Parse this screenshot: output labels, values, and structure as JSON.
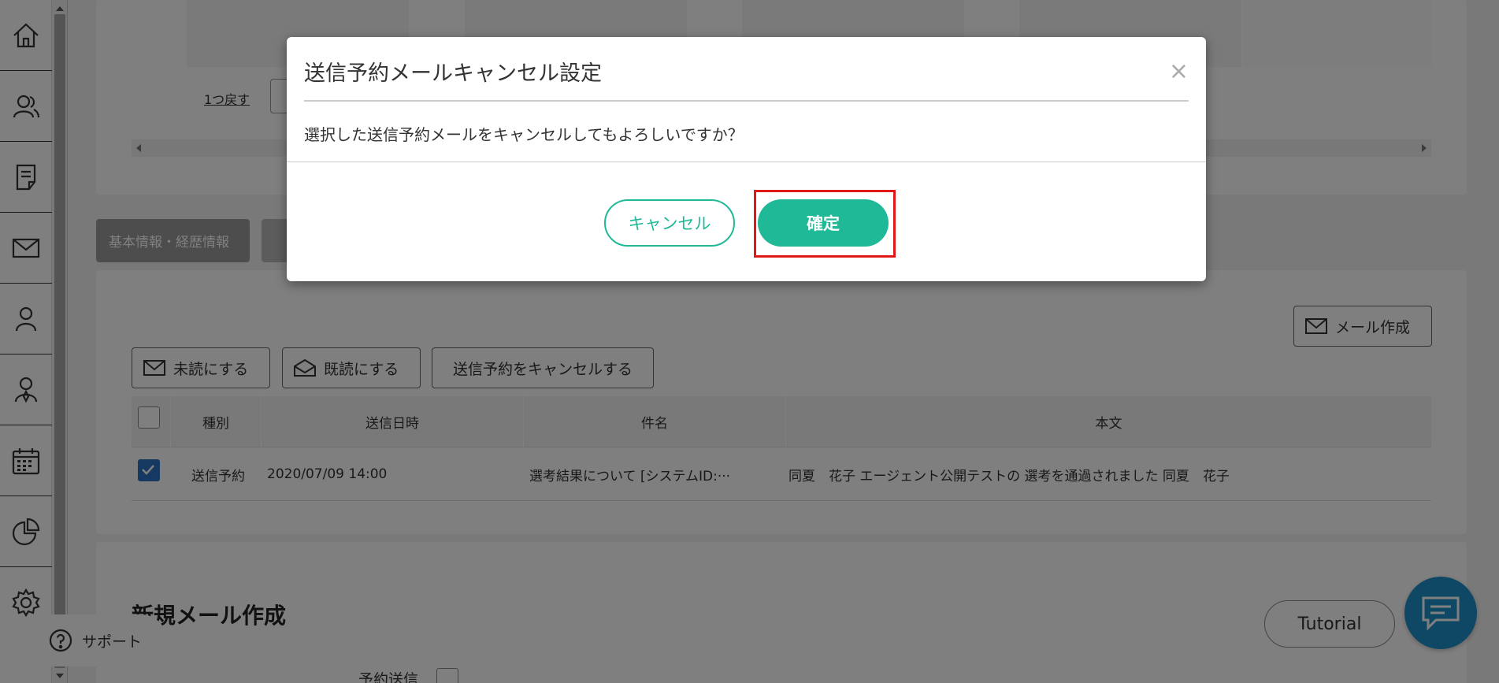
{
  "sidebar": {
    "items": [
      {
        "icon": "home-icon"
      },
      {
        "icon": "users-icon"
      },
      {
        "icon": "document-icon"
      },
      {
        "icon": "mail-icon"
      },
      {
        "icon": "user-icon"
      },
      {
        "icon": "agent-icon"
      },
      {
        "icon": "calendar-icon"
      },
      {
        "icon": "pie-chart-icon"
      },
      {
        "icon": "gear-icon"
      }
    ]
  },
  "top_section": {
    "back_link": "1つ戻す"
  },
  "tabs": {
    "basic_info": "基本情報・経歴情報"
  },
  "mail_section": {
    "create_mail": "メール作成",
    "mark_unread": "未読にする",
    "mark_read": "既読にする",
    "cancel_scheduled": "送信予約をキャンセルする",
    "columns": [
      "種別",
      "送信日時",
      "件名",
      "本文"
    ],
    "rows": [
      {
        "checked": true,
        "type": "送信予約",
        "sent_at": "2020/07/09 14:00",
        "subject": "選考結果について [システムID:···",
        "body": "同夏　花子 エージェント公開テストの 選考を通過されました 同夏　花子"
      }
    ]
  },
  "new_mail": {
    "title": "新規メール作成",
    "reserve_label": "予約送信",
    "tutorial": "Tutorial"
  },
  "support": {
    "label": "サポート"
  },
  "modal": {
    "title": "送信予約メールキャンセル設定",
    "close": "×",
    "message": "選択した送信予約メールをキャンセルしてもよろしいですか？",
    "cancel_label": "キャンセル",
    "confirm_label": "確定"
  },
  "colors": {
    "accent": "#20b998",
    "highlight": "#e01818",
    "chat": "#1e90c8"
  }
}
